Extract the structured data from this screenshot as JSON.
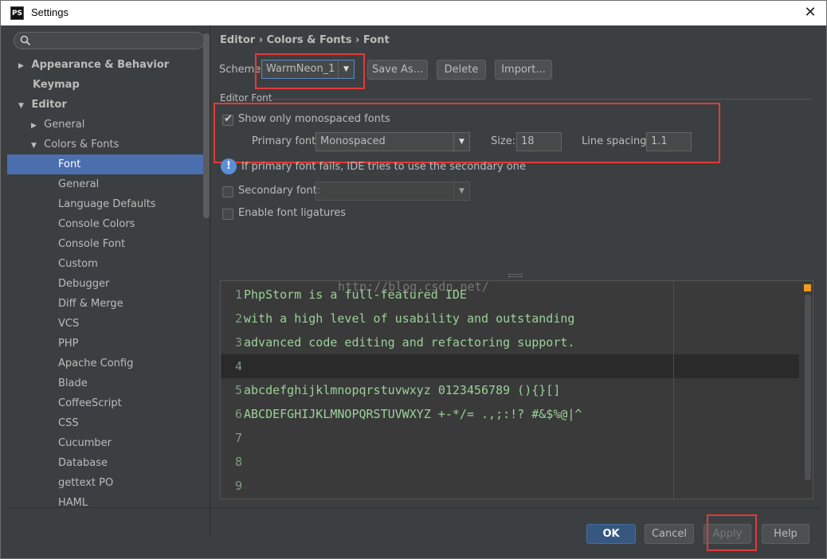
{
  "window": {
    "title": "Settings",
    "app_icon_text": "PS",
    "close_glyph": "✕"
  },
  "search": {
    "placeholder": ""
  },
  "sidebar": {
    "items": [
      {
        "label": "Appearance & Behavior",
        "arrow": "▶",
        "bold": true
      },
      {
        "label": "Keymap",
        "arrow": "",
        "bold": true
      },
      {
        "label": "Editor",
        "arrow": "▼",
        "bold": true
      },
      {
        "label": "General",
        "arrow": "▶",
        "bold": false
      },
      {
        "label": "Colors & Fonts",
        "arrow": "▼",
        "bold": false
      },
      {
        "label": "Font",
        "arrow": "",
        "bold": false,
        "selected": true
      },
      {
        "label": "General",
        "arrow": "",
        "bold": false
      },
      {
        "label": "Language Defaults",
        "arrow": "",
        "bold": false
      },
      {
        "label": "Console Colors",
        "arrow": "",
        "bold": false
      },
      {
        "label": "Console Font",
        "arrow": "",
        "bold": false
      },
      {
        "label": "Custom",
        "arrow": "",
        "bold": false
      },
      {
        "label": "Debugger",
        "arrow": "",
        "bold": false
      },
      {
        "label": "Diff & Merge",
        "arrow": "",
        "bold": false
      },
      {
        "label": "VCS",
        "arrow": "",
        "bold": false
      },
      {
        "label": "PHP",
        "arrow": "",
        "bold": false
      },
      {
        "label": "Apache Config",
        "arrow": "",
        "bold": false
      },
      {
        "label": "Blade",
        "arrow": "",
        "bold": false
      },
      {
        "label": "CoffeeScript",
        "arrow": "",
        "bold": false
      },
      {
        "label": "CSS",
        "arrow": "",
        "bold": false
      },
      {
        "label": "Cucumber",
        "arrow": "",
        "bold": false
      },
      {
        "label": "Database",
        "arrow": "",
        "bold": false
      },
      {
        "label": "gettext PO",
        "arrow": "",
        "bold": false
      },
      {
        "label": "HAML",
        "arrow": "",
        "bold": false
      }
    ]
  },
  "breadcrumb": "Editor › Colors & Fonts › Font",
  "scheme": {
    "label": "Scheme:",
    "value": "WarmNeon_1",
    "save_as": "Save As...",
    "delete": "Delete",
    "import": "Import..."
  },
  "editor_font": {
    "section_label": "Editor Font",
    "show_mono_label": "Show only monospaced fonts",
    "show_mono_checked": true,
    "primary_font_label": "Primary font:",
    "primary_font_value": "Monospaced",
    "size_label": "Size:",
    "size_value": "18",
    "line_spacing_label": "Line spacing:",
    "line_spacing_value": "1.1",
    "info_text": "If primary font fails, IDE tries to use the secondary one",
    "secondary_font_label": "Secondary font:",
    "secondary_font_value": "",
    "ligatures_label": "Enable font ligatures"
  },
  "preview": {
    "lines": [
      {
        "num": "1",
        "text": "PhpStorm is a full-featured IDE"
      },
      {
        "num": "2",
        "text": "with a high level of usability and outstanding"
      },
      {
        "num": "3",
        "text": "advanced code editing and refactoring support."
      },
      {
        "num": "4",
        "text": ""
      },
      {
        "num": "5",
        "text": "abcdefghijklmnopqrstuvwxyz 0123456789 (){}[]"
      },
      {
        "num": "6",
        "text": "ABCDEFGHIJKLMNOPQRSTUVWXYZ +-*/= .,;:!? #&$%@|^"
      },
      {
        "num": "7",
        "text": ""
      },
      {
        "num": "8",
        "text": ""
      },
      {
        "num": "9",
        "text": ""
      }
    ],
    "watermark": "http://blog.csdn.net/"
  },
  "footer": {
    "ok": "OK",
    "cancel": "Cancel",
    "apply": "Apply",
    "help": "Help"
  },
  "colors": {
    "accent": "#4b6eaf",
    "highlight": "#e23a3a",
    "ok_button": "#365880"
  }
}
